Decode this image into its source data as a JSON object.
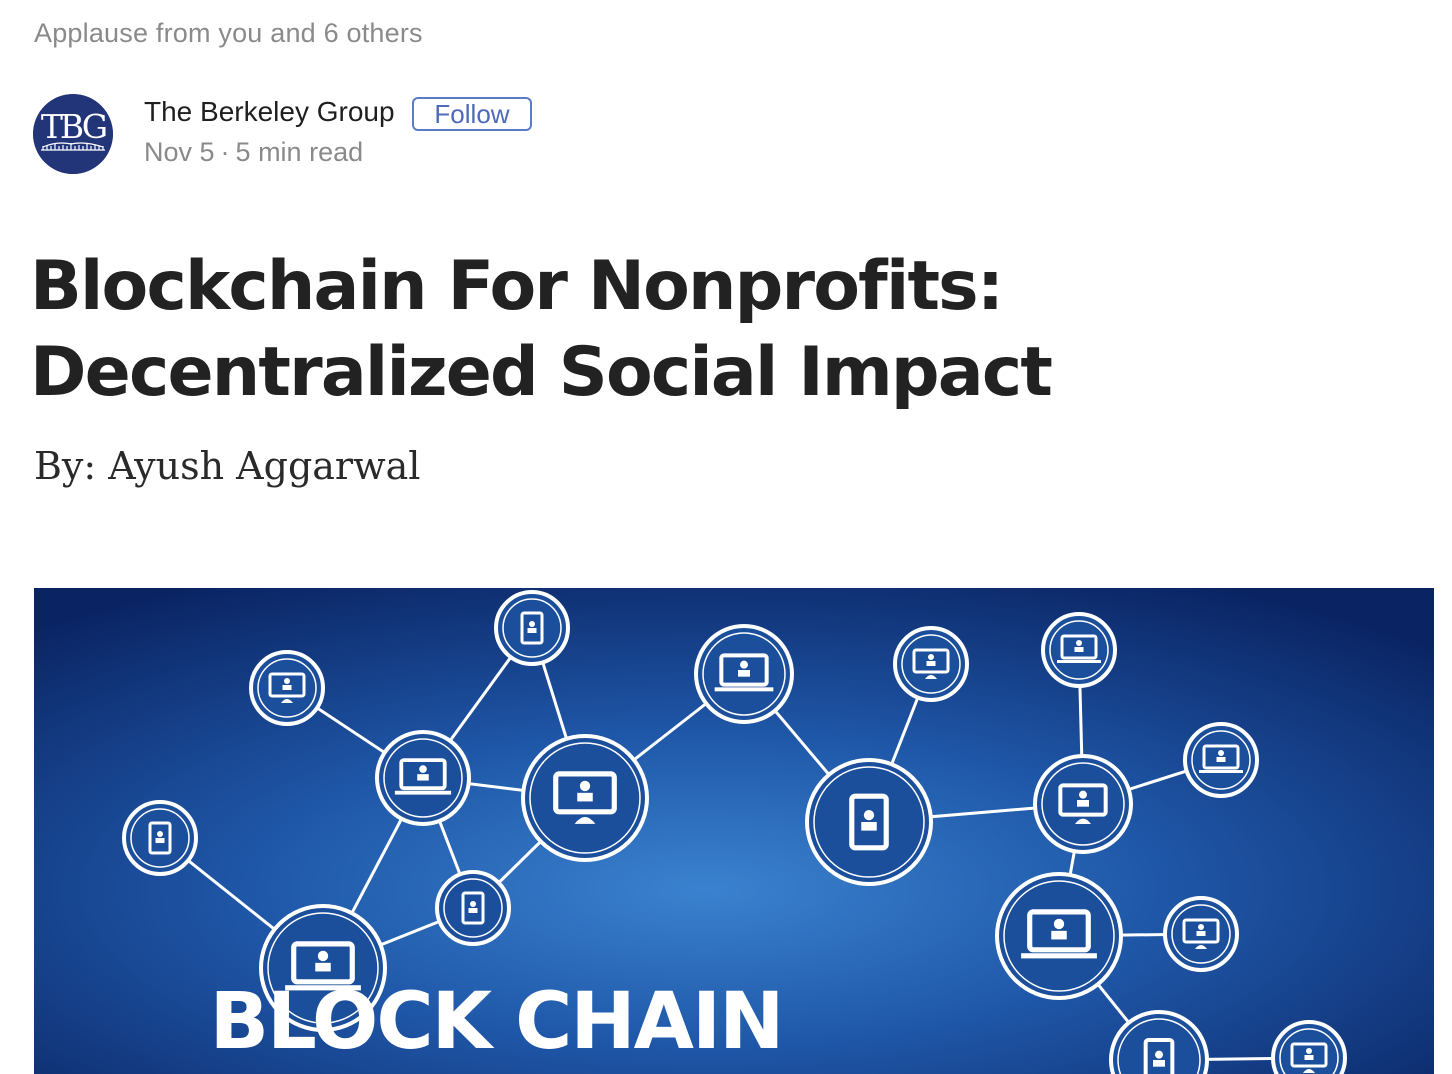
{
  "post": {
    "applause": "Applause from you and 6 others",
    "author": {
      "name": "The Berkeley Group",
      "avatar_text": "TBG",
      "follow_label": "Follow"
    },
    "date": "Nov 5",
    "separator": "·",
    "read_time": "5 min read",
    "title": "Blockchain For Nonprofits: Decentralized Social Impact",
    "byline": "By: Ayush Aggarwal",
    "hero_image": {
      "caption_text": "BLOCK CHAIN"
    }
  },
  "colors": {
    "accent": "#4d6bb8",
    "avatar_bg": "#223578",
    "muted_text": "#8a8a8a",
    "hero_bg_dark": "#0b2a6b",
    "hero_bg_light": "#2e6fc0"
  }
}
